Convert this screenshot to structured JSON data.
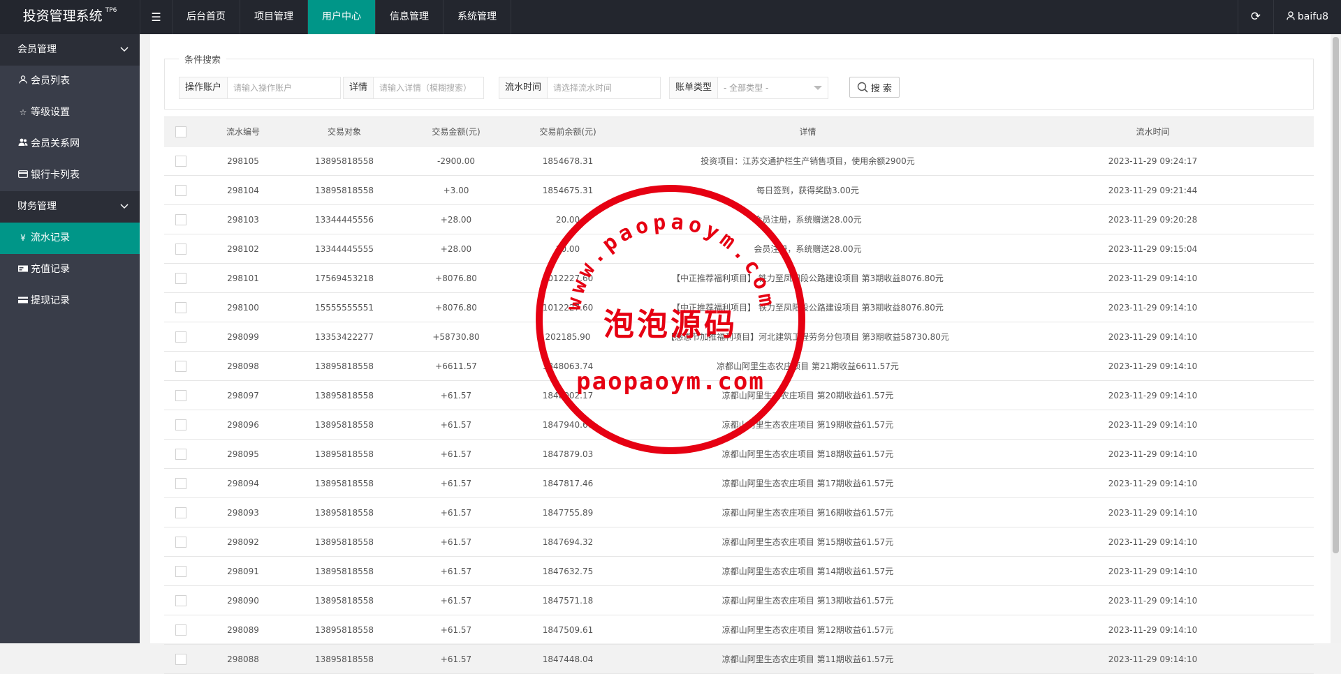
{
  "app": {
    "title": "投资管理系统",
    "version_tag": "TP6"
  },
  "topnav": {
    "toggle_icon": "☰",
    "items": [
      "后台首页",
      "项目管理",
      "用户中心",
      "信息管理",
      "系统管理"
    ],
    "active_index": 2,
    "refresh_icon": "⟳",
    "user": "baifu8"
  },
  "sidebar": {
    "groups": [
      {
        "label": "会员管理",
        "items": [
          {
            "label": "会员列表",
            "icon": "user-icon"
          },
          {
            "label": "等级设置",
            "icon": "star-icon"
          },
          {
            "label": "会员关系网",
            "icon": "users-icon"
          },
          {
            "label": "银行卡列表",
            "icon": "credit-card-icon"
          }
        ]
      },
      {
        "label": "财务管理",
        "items": [
          {
            "label": "流水记录",
            "icon": "yen-icon",
            "active": true
          },
          {
            "label": "充值记录",
            "icon": "recharge-icon"
          },
          {
            "label": "提现记录",
            "icon": "withdraw-icon"
          }
        ]
      }
    ]
  },
  "search": {
    "legend": "条件搜索",
    "account_label": "操作账户",
    "account_placeholder": "请输入操作账户",
    "detail_label": "详情",
    "detail_placeholder": "请输入详情（模糊搜索）",
    "time_label": "流水时间",
    "time_placeholder": "请选择流水时间",
    "type_label": "账单类型",
    "type_value": "- 全部类型 -",
    "button": "搜 索"
  },
  "table": {
    "headers": [
      "流水编号",
      "交易对象",
      "交易金额(元)",
      "交易前余额(元)",
      "详情",
      "流水时间"
    ],
    "rows": [
      {
        "id": "298105",
        "target": "13895818558",
        "amount": "-2900.00",
        "before": "1854678.31",
        "detail": "投资项目：江苏交通护栏生产销售项目，使用余额2900元",
        "time": "2023-11-29 09:24:17"
      },
      {
        "id": "298104",
        "target": "13895818558",
        "amount": "+3.00",
        "before": "1854675.31",
        "detail": "每日签到，获得奖励3.00元",
        "time": "2023-11-29 09:21:44"
      },
      {
        "id": "298103",
        "target": "13344445556",
        "amount": "+28.00",
        "before": "20.00",
        "detail": "会员注册，系统赠送28.00元",
        "time": "2023-11-29 09:20:28"
      },
      {
        "id": "298102",
        "target": "13344445555",
        "amount": "+28.00",
        "before": "20.00",
        "detail": "会员注册，系统赠送28.00元",
        "time": "2023-11-29 09:15:04"
      },
      {
        "id": "298101",
        "target": "17569453218",
        "amount": "+8076.80",
        "before": "1012227.60",
        "detail": "【中正推荐福利项目】 铁力至凤阳段公路建设项目 第3期收益8076.80元",
        "time": "2023-11-29 09:14:10"
      },
      {
        "id": "298100",
        "target": "15555555551",
        "amount": "+8076.80",
        "before": "1012227.60",
        "detail": "【中正推荐福利项目】 铁力至凤阳段公路建设项目 第3期收益8076.80元",
        "time": "2023-11-29 09:14:10"
      },
      {
        "id": "298099",
        "target": "13353422277",
        "amount": "+58730.80",
        "before": "202185.90",
        "detail": "【感恩节加推福利项目】河北建筑工程劳务分包项目 第3期收益58730.80元",
        "time": "2023-11-29 09:14:10"
      },
      {
        "id": "298098",
        "target": "13895818558",
        "amount": "+6611.57",
        "before": "1848063.74",
        "detail": "凉都山阿里生态农庄项目 第21期收益6611.57元",
        "time": "2023-11-29 09:14:10"
      },
      {
        "id": "298097",
        "target": "13895818558",
        "amount": "+61.57",
        "before": "1848002.17",
        "detail": "凉都山阿里生态农庄项目 第20期收益61.57元",
        "time": "2023-11-29 09:14:10"
      },
      {
        "id": "298096",
        "target": "13895818558",
        "amount": "+61.57",
        "before": "1847940.60",
        "detail": "凉都山阿里生态农庄项目 第19期收益61.57元",
        "time": "2023-11-29 09:14:10"
      },
      {
        "id": "298095",
        "target": "13895818558",
        "amount": "+61.57",
        "before": "1847879.03",
        "detail": "凉都山阿里生态农庄项目 第18期收益61.57元",
        "time": "2023-11-29 09:14:10"
      },
      {
        "id": "298094",
        "target": "13895818558",
        "amount": "+61.57",
        "before": "1847817.46",
        "detail": "凉都山阿里生态农庄项目 第17期收益61.57元",
        "time": "2023-11-29 09:14:10"
      },
      {
        "id": "298093",
        "target": "13895818558",
        "amount": "+61.57",
        "before": "1847755.89",
        "detail": "凉都山阿里生态农庄项目 第16期收益61.57元",
        "time": "2023-11-29 09:14:10"
      },
      {
        "id": "298092",
        "target": "13895818558",
        "amount": "+61.57",
        "before": "1847694.32",
        "detail": "凉都山阿里生态农庄项目 第15期收益61.57元",
        "time": "2023-11-29 09:14:10"
      },
      {
        "id": "298091",
        "target": "13895818558",
        "amount": "+61.57",
        "before": "1847632.75",
        "detail": "凉都山阿里生态农庄项目 第14期收益61.57元",
        "time": "2023-11-29 09:14:10"
      },
      {
        "id": "298090",
        "target": "13895818558",
        "amount": "+61.57",
        "before": "1847571.18",
        "detail": "凉都山阿里生态农庄项目 第13期收益61.57元",
        "time": "2023-11-29 09:14:10"
      },
      {
        "id": "298089",
        "target": "13895818558",
        "amount": "+61.57",
        "before": "1847509.61",
        "detail": "凉都山阿里生态农庄项目 第12期收益61.57元",
        "time": "2023-11-29 09:14:10"
      },
      {
        "id": "298088",
        "target": "13895818558",
        "amount": "+61.57",
        "before": "1847448.04",
        "detail": "凉都山阿里生态农庄项目 第11期收益61.57元",
        "time": "2023-11-29 09:14:10"
      }
    ]
  },
  "watermark": {
    "top_text": "www.paopaoym.com",
    "middle_text": "泡泡源码",
    "bottom_text": "paopaoym.com",
    "color": "#e60012"
  },
  "colors": {
    "accent": "#009688",
    "header_bg": "#23262e",
    "sidebar_bg": "#393d49",
    "negative": "#ff5722",
    "positive": "#009900"
  }
}
